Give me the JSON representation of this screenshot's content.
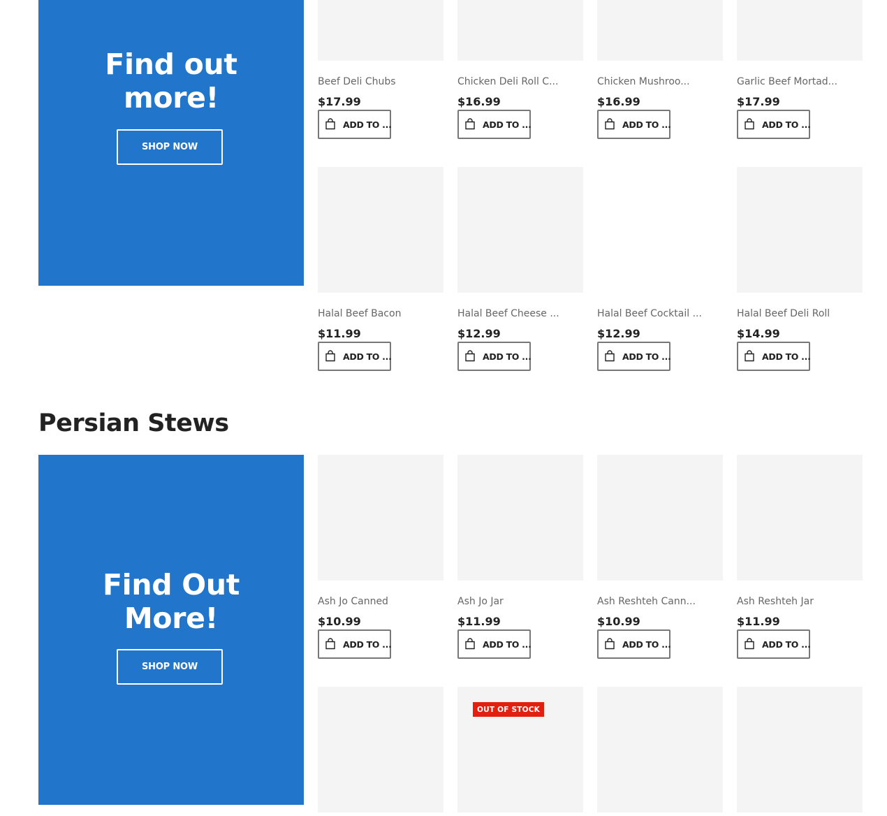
{
  "section1": {
    "promo": {
      "title_line1": "Find out",
      "title_line2": "more!",
      "button": "SHOP NOW"
    },
    "products": [
      {
        "name": "Beef Deli Chubs",
        "price": "$17.99",
        "add_label": "ADD TO ..."
      },
      {
        "name": "Chicken Deli Roll C...",
        "price": "$16.99",
        "add_label": "ADD TO ..."
      },
      {
        "name": "Chicken Mushroo...",
        "price": "$16.99",
        "add_label": "ADD TO ..."
      },
      {
        "name": "Garlic Beef Mortad...",
        "price": "$17.99",
        "add_label": "ADD TO ..."
      },
      {
        "name": "Halal Beef Bacon",
        "price": "$11.99",
        "add_label": "ADD TO ..."
      },
      {
        "name": "Halal Beef Cheese ...",
        "price": "$12.99",
        "add_label": "ADD TO ..."
      },
      {
        "name": "Halal Beef Cocktail ...",
        "price": "$12.99",
        "add_label": "ADD TO ..."
      },
      {
        "name": "Halal Beef Deli Roll",
        "price": "$14.99",
        "add_label": "ADD TO ..."
      }
    ]
  },
  "section2": {
    "heading": "Persian Stews",
    "promo": {
      "title_line1": "Find Out",
      "title_line2": "More!",
      "button": "SHOP NOW"
    },
    "products": [
      {
        "name": "Ash Jo Canned",
        "price": "$10.99",
        "add_label": "ADD TO ..."
      },
      {
        "name": "Ash Jo Jar",
        "price": "$11.99",
        "add_label": "ADD TO ..."
      },
      {
        "name": "Ash Reshteh Cann...",
        "price": "$10.99",
        "add_label": "ADD TO ..."
      },
      {
        "name": "Ash Reshteh Jar",
        "price": "$11.99",
        "add_label": "ADD TO ..."
      }
    ],
    "out_of_stock_badge": "OUT OF STOCK"
  },
  "colors": {
    "promo_blue": "#2175cb",
    "thumb_gray": "#f4f4f4",
    "badge_red": "#e3200f"
  },
  "icons": {
    "cart": "shopping-bag-icon"
  }
}
